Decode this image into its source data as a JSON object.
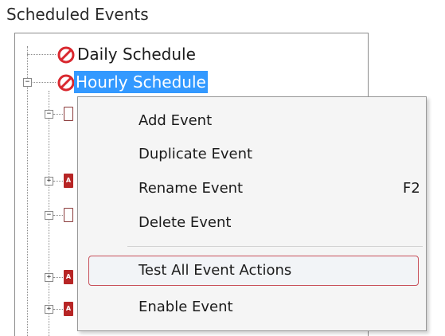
{
  "group": {
    "label": "Scheduled Events"
  },
  "tree": {
    "nodes": [
      {
        "label": "Daily Schedule",
        "icon": "disabled-icon"
      },
      {
        "label": "Hourly Schedule",
        "icon": "disabled-icon",
        "selected": true,
        "expander": "−"
      }
    ],
    "child_expanders": [
      "−",
      "+",
      "−",
      "+",
      "+"
    ],
    "child_icon_text": "A"
  },
  "context_menu": {
    "items": [
      {
        "label": "Add Event",
        "shortcut": ""
      },
      {
        "label": "Duplicate Event",
        "shortcut": ""
      },
      {
        "label": "Rename Event",
        "shortcut": "F2"
      },
      {
        "label": "Delete Event",
        "shortcut": ""
      },
      {
        "label": "Test All Event Actions",
        "shortcut": "",
        "hovered": true
      },
      {
        "label": "Enable Event",
        "shortcut": ""
      }
    ]
  },
  "colors": {
    "selection": "#3399ff",
    "hover_border": "#c8505a",
    "disabled_icon_red": "#d9282f",
    "event_icon_red": "#b72525"
  }
}
